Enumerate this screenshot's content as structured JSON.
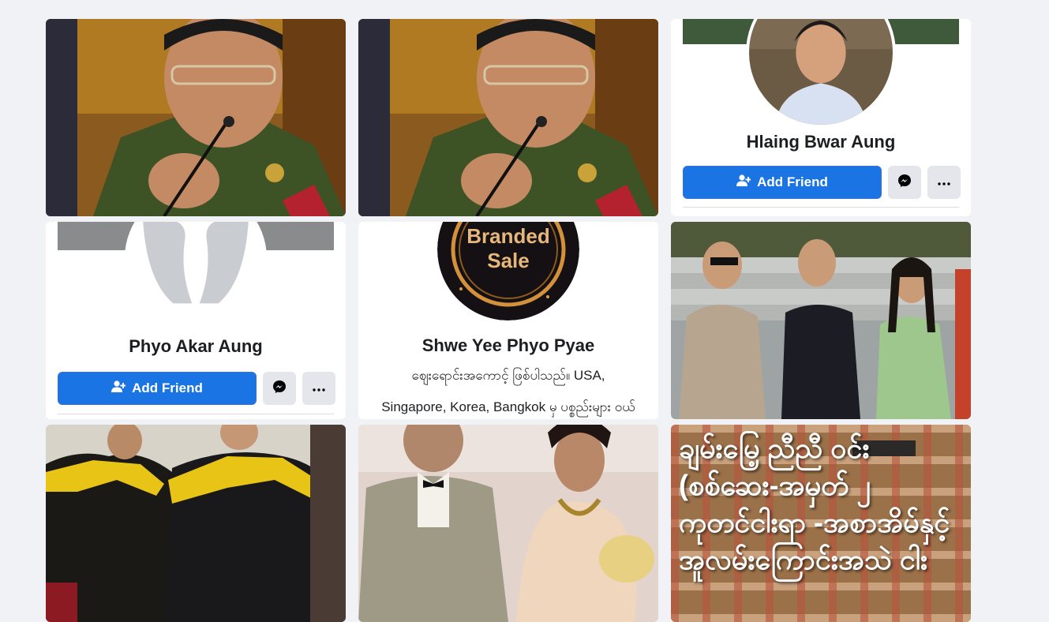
{
  "cards": [
    {
      "name": "Hlaing Bwar Aung",
      "add_label": "Add Friend"
    },
    {
      "name": "Phyo Akar Aung",
      "add_label": "Add Friend"
    },
    {
      "name": "Shwe Yee Phyo Pyae",
      "bio_line1": "ဈေးရောင်းအကောင့် ဖြစ်ပါသည်။ USA,",
      "bio_line2": "Singapore, Korea, Bangkok မှ ပစ္စည်းများ ဝယ်",
      "avatar_text_line1": "Branded",
      "avatar_text_line2": "Sale"
    }
  ],
  "overlay_caption": {
    "line1": "ချမ်းမြေ့ ညီညီ ဝင်း",
    "line2": "(စစ်ဆေး-အမှတ် ၂",
    "line3": "ကုတင်ငါးရာ -အစာအိမ်နှင့်",
    "line4": "အူလမ်းကြောင်းအသဲ ငါး"
  },
  "icons": [
    "add-friend-icon",
    "messenger-icon",
    "more-options-icon"
  ],
  "colors": {
    "primary_button": "#1b74e4",
    "page_bg": "#f0f2f5"
  }
}
